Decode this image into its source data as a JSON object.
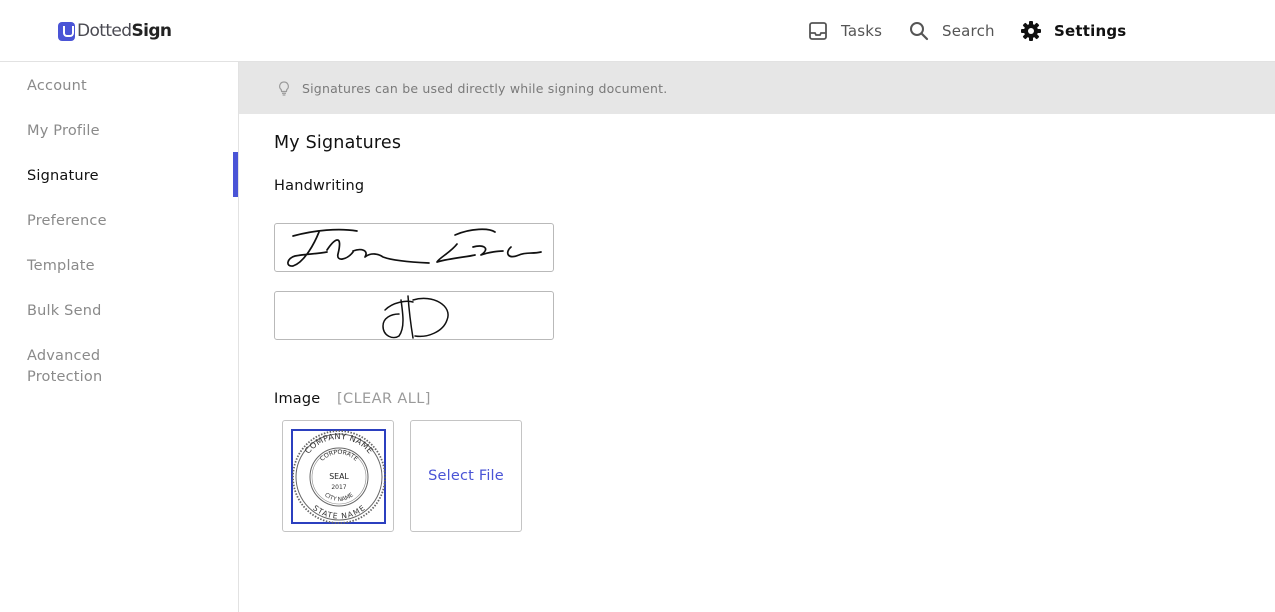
{
  "app": {
    "logo_text_dotted": "Dotted",
    "logo_text_sign": "Sign",
    "logo_icon": "dottedsign-logo-icon"
  },
  "nav": {
    "tasks": {
      "label": "Tasks",
      "icon": "inbox-tray-icon"
    },
    "search": {
      "label": "Search",
      "icon": "search-icon"
    },
    "settings": {
      "label": "Settings",
      "icon": "gear-icon",
      "active": true
    }
  },
  "sidebar": {
    "items": [
      {
        "label": "Account"
      },
      {
        "label": "My Profile"
      },
      {
        "label": "Signature",
        "active": true
      },
      {
        "label": "Preference"
      },
      {
        "label": "Template"
      },
      {
        "label": "Bulk Send"
      },
      {
        "label": "Advanced Protection"
      }
    ]
  },
  "banner": {
    "icon": "lightbulb-icon",
    "text": "Signatures can be used directly while signing document."
  },
  "main": {
    "title": "My Signatures",
    "handwriting_label": "Handwriting",
    "image_label": "Image",
    "clear_all": "[CLEAR ALL]",
    "select_file": "Select File",
    "seal": {
      "outer_top": "COMPANY NAME",
      "inner_top": "CORPORATE",
      "center": "SEAL",
      "year": "2017",
      "inner_bottom": "CITY NAME",
      "outer_bottom": "STATE NAME"
    }
  },
  "colors": {
    "accent": "#4a54d6",
    "seal_frame": "#2b3fbf",
    "banner_bg": "#e6e6e6",
    "muted_text": "#8a8a8a"
  }
}
